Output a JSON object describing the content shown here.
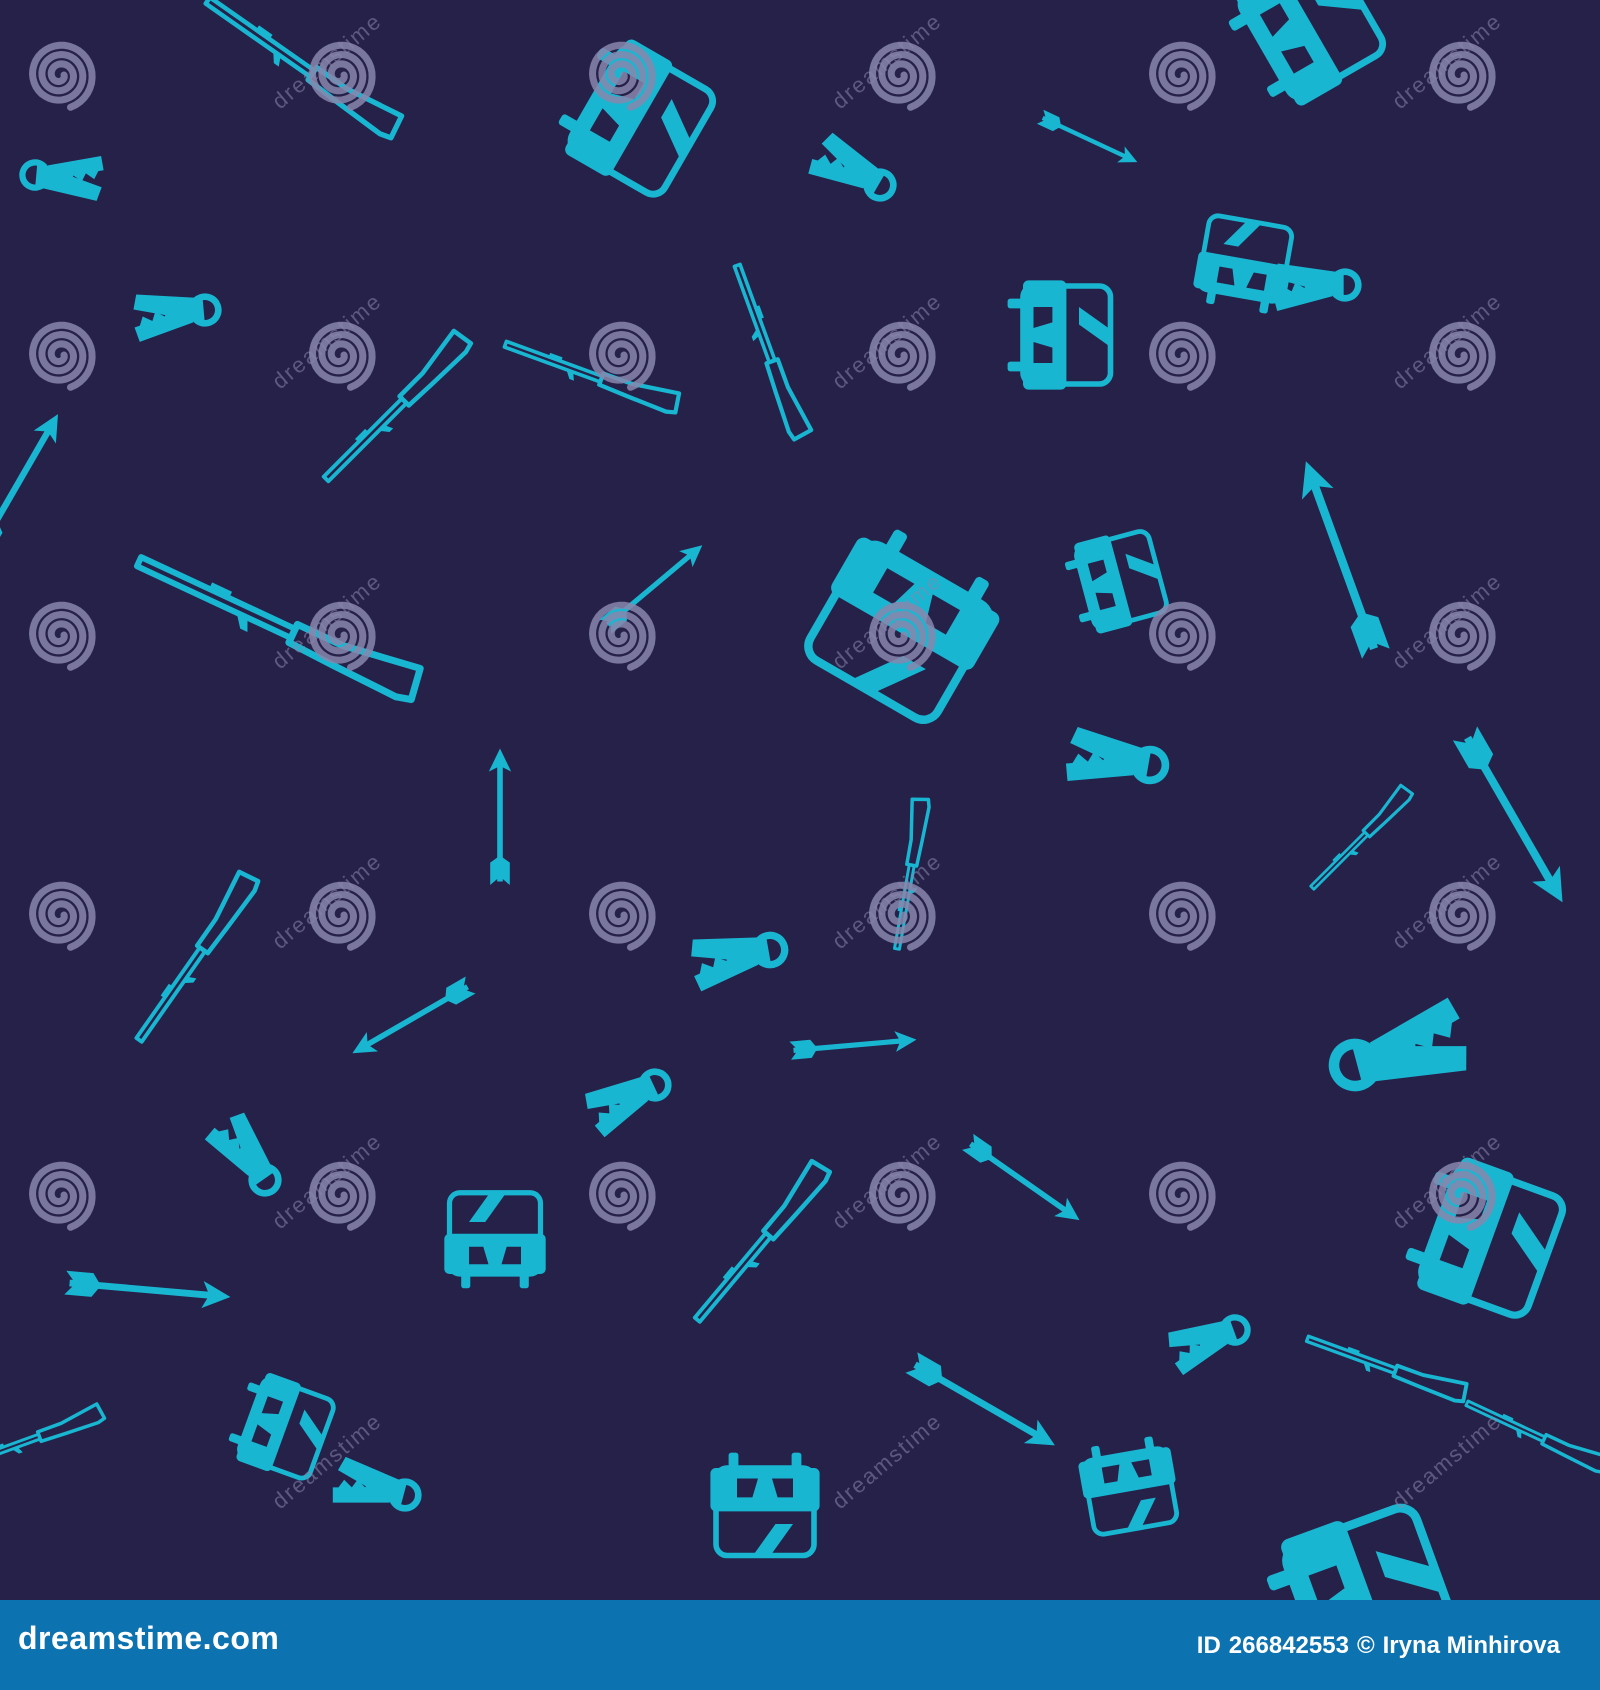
{
  "palette": {
    "background": "#262149",
    "icon": "#19b6d2",
    "watermark": "#8a86ad",
    "footer": "#0d72b0",
    "footer_text": "#ffffff"
  },
  "icon_names": [
    "folding-knife-icon",
    "hunting-rifle-icon",
    "arrow-icon",
    "backpack-icon",
    "watermark-spiral-icon"
  ],
  "watermark": {
    "text": "dreamstime"
  },
  "footer": {
    "site": "dreamstime.com",
    "id_label": "ID",
    "id_value": "266842553",
    "copyright": "©",
    "author": "Iryna Minhirova"
  }
}
